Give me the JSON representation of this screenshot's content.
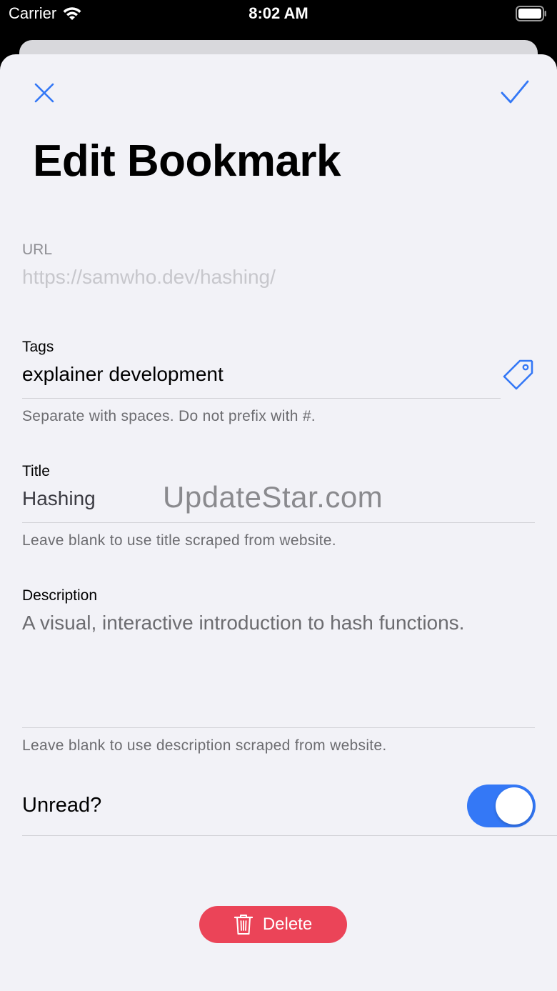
{
  "status": {
    "carrier": "Carrier",
    "time": "8:02 AM"
  },
  "header": {
    "title": "Edit Bookmark"
  },
  "form": {
    "url": {
      "label": "URL",
      "value": "https://samwho.dev/hashing/"
    },
    "tags": {
      "label": "Tags",
      "value": "explainer development",
      "help": "Separate with spaces. Do not prefix with #."
    },
    "title": {
      "label": "Title",
      "value": "Hashing",
      "help": "Leave blank to use title scraped from website."
    },
    "description": {
      "label": "Description",
      "value": "A visual, interactive introduction to hash functions.",
      "help": "Leave blank to use description scraped from website."
    },
    "unread": {
      "label": "Unread?",
      "on": true
    }
  },
  "actions": {
    "delete_label": "Delete"
  },
  "watermark": "UpdateStar.com",
  "colors": {
    "accent": "#3478f6",
    "destructive": "#eb4458",
    "background": "#f2f2f7"
  }
}
